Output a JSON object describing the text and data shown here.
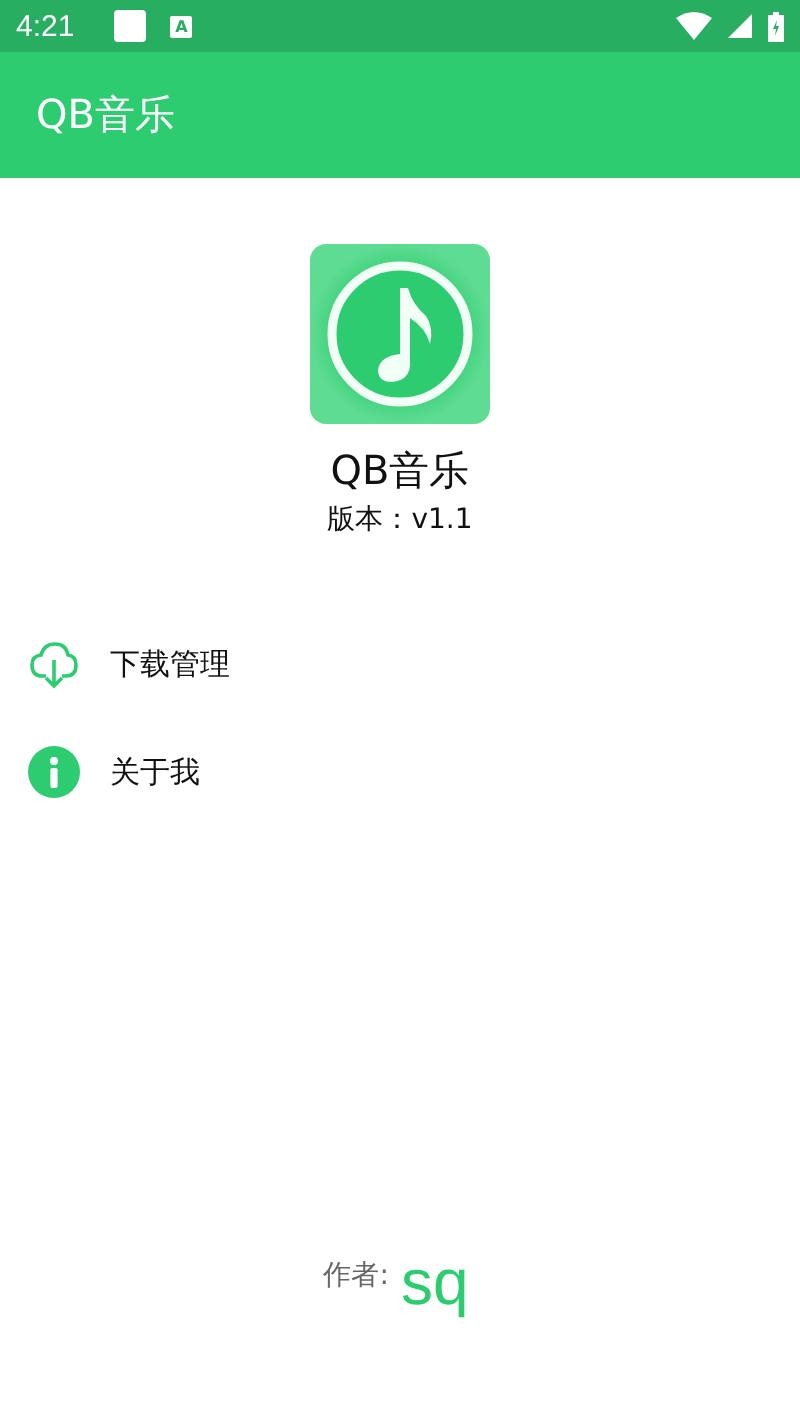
{
  "status_bar": {
    "time": "4:21",
    "notification_letter": "A"
  },
  "app_bar": {
    "title": "QB音乐"
  },
  "about": {
    "app_name": "QB音乐",
    "version": "版本：v1.1"
  },
  "menu": [
    {
      "kind": "download",
      "label": "下载管理"
    },
    {
      "kind": "info",
      "label": "关于我"
    }
  ],
  "footer": {
    "label": "作者:",
    "author": "sq"
  }
}
